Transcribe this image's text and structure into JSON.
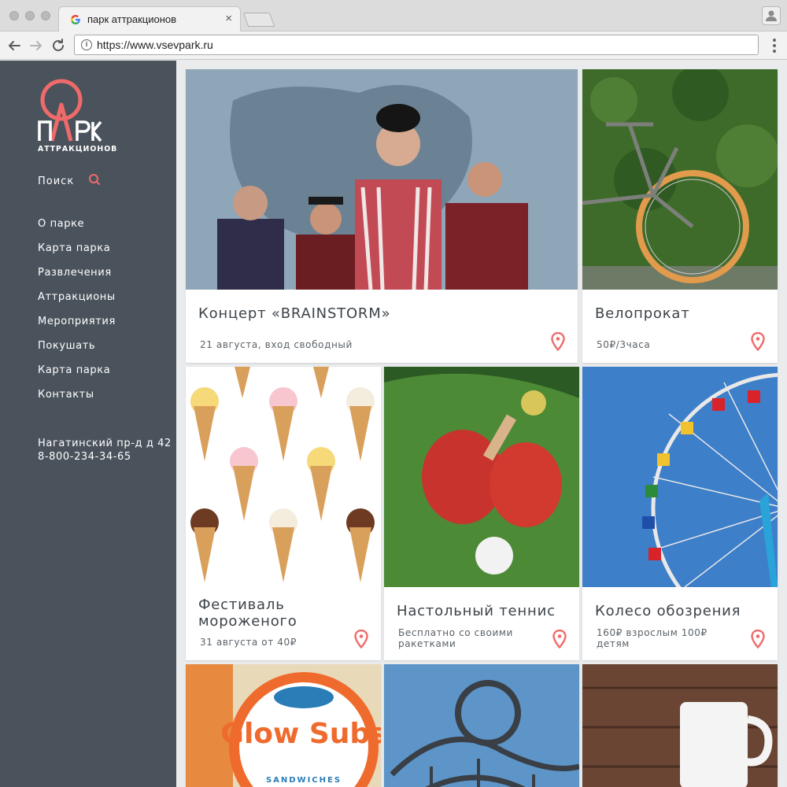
{
  "browser": {
    "tab_title": "парк аттракционов",
    "tab_close": "×",
    "url": "https://www.vsevpark.ru"
  },
  "logo": {
    "main": "ПАРК",
    "sub": "АТТРАКЦИОНОВ",
    "accent_color": "#f16a6a"
  },
  "sidebar": {
    "search_label": "Поиск",
    "menu": [
      "О парке",
      "Карта парка",
      "Развлечения",
      "Аттракционы",
      "Мероприятия",
      "Покушать",
      "Карта парка",
      "Контакты"
    ],
    "address": "Нагатинский пр-д д 42",
    "phone": "8-800-234-34-65",
    "bg_color": "#4a535c"
  },
  "cards": [
    {
      "title": "Концерт «BRAINSTORM»",
      "subtitle": "21 августа, вход свободный"
    },
    {
      "title": "Велопрокат",
      "subtitle": "50₽/3часа"
    },
    {
      "title": "Фестиваль мороженого",
      "subtitle": "31 августа от 40₽"
    },
    {
      "title": "Настольный теннис",
      "subtitle": "Бесплатно со своими ракетками"
    },
    {
      "title": "Колесо обозрения",
      "subtitle": "160₽ взрослым 100₽ детям"
    },
    {
      "title": "Glow Subs",
      "subtitle": "SANDWICHES"
    }
  ],
  "icons": {
    "pin_color": "#f16a6a"
  }
}
